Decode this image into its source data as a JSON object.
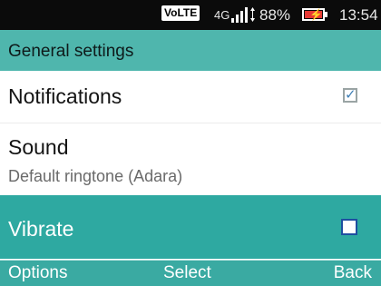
{
  "status_bar": {
    "volte_badge": "VoLTE",
    "network_type": "4G",
    "battery_percent": "88%",
    "battery_level": 0.88,
    "battery_charging": true,
    "time": "13:54"
  },
  "header": {
    "title": "General settings"
  },
  "settings": {
    "notifications": {
      "label": "Notifications",
      "checked": true
    },
    "sound": {
      "label": "Sound",
      "value": "Default ringtone (Adara)"
    },
    "vibrate": {
      "label": "Vibrate",
      "checked": false,
      "selected": true
    }
  },
  "softkeys": {
    "left": "Options",
    "center": "Select",
    "right": "Back"
  },
  "colors": {
    "accent": "#4fb6ad",
    "selected_row": "#2ea9a1",
    "softkey_bar": "#3aaaa2",
    "battery_charge": "#e53935"
  }
}
